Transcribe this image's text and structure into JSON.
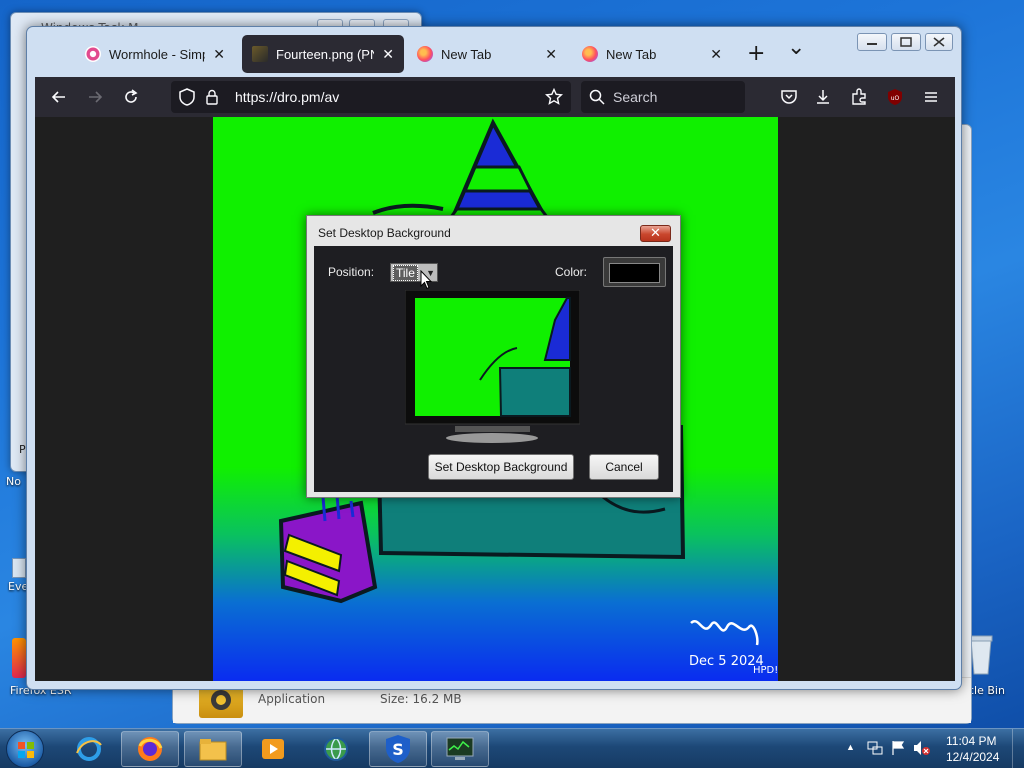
{
  "desktop": {
    "labels": {
      "note": "No",
      "every": "Eve",
      "firebox": "Firefox ESR",
      "recycle": "cle Bin"
    }
  },
  "background_window": {
    "title": "Windows Task M...",
    "info": {
      "type": "Application",
      "size": "Size: 16.2 MB",
      "side_letter": "P"
    }
  },
  "browser": {
    "tabs": [
      {
        "label": "Wormhole - Simple",
        "active": false
      },
      {
        "label": "Fourteen.png (PNG",
        "active": true
      },
      {
        "label": "New Tab",
        "active": false
      },
      {
        "label": "New Tab",
        "active": false
      }
    ],
    "new_tab_symbol": "+",
    "list_tabs_symbol": "⌄",
    "url": "https://dro.pm/av",
    "search_placeholder": "Search"
  },
  "artwork": {
    "signature": "Dec 5 2024",
    "signature_suffix": "HPD!"
  },
  "dialog": {
    "title": "Set Desktop Background",
    "close_symbol": "✕",
    "position_label": "Position:",
    "position_value": "Tile",
    "color_label": "Color:",
    "color_value": "#000000",
    "set_button": "Set Desktop Background",
    "cancel_button": "Cancel"
  },
  "taskbar": {
    "time": "11:04 PM",
    "date": "12/4/2024",
    "show_hidden": "▲"
  },
  "colors": {
    "browser_chrome": "#2b2a33",
    "art_green": "#10f000",
    "art_blue": "#0a2cf0",
    "art_teal": "#0f7f7a"
  }
}
